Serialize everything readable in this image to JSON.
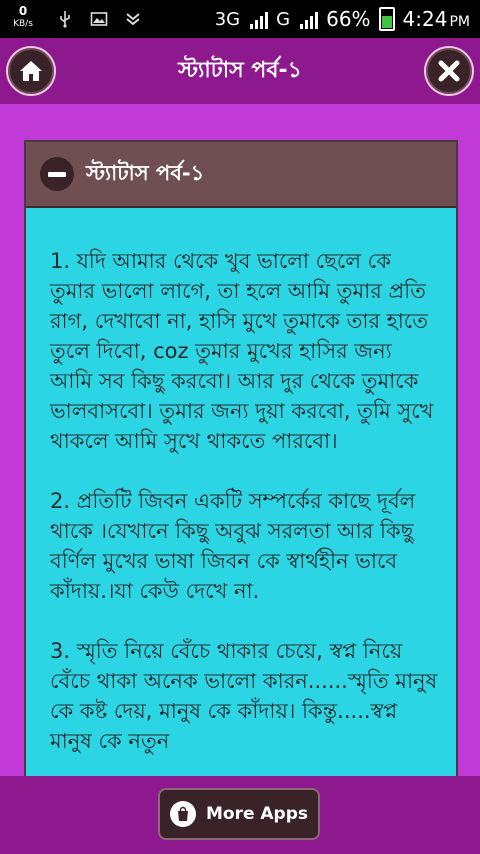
{
  "status_bar": {
    "speed_value": "0",
    "speed_unit": "KB/s",
    "network_1": "3G",
    "network_2": "G",
    "battery": "66%",
    "time": "4:24",
    "ampm": "PM"
  },
  "header": {
    "title": "স্ট্যাটাস পর্ব-১",
    "home_icon": "home-icon",
    "close_icon": "close-icon"
  },
  "panel": {
    "title": "স্ট্যাটাস পর্ব-১",
    "paragraphs": [
      "1. যদি আমার থেকে খুব ভালো ছেলে কে তুমার ভালো লাগে, তা হলে আমি তুমার প্রতি রাগ, দেখাবো না, হাসি মুখে তুমাকে তার হাতে তুলে দিবো, coz তুমার মুখের হাসির জন্য আমি সব কিছু করবো। আর দুর থেকে তুমাকে ভালবাসবো। তুমার জন্য দুয়া করবো, তুমি সুখে থাকলে আমি সুখে থাকতে পারবো।",
      "2. প্রতিটি জিবন একটি সম্পর্কের কাছে দূর্বল থাকে ।যেখানে কিছু অবুঝ সরলতা আর কিছু বর্ণিল মুখের ভাষা জিবন কে স্বার্থহীন ভাবে কাঁদায়.।যা কেউ দেখে না.",
      "3. স্মৃতি নিয়ে বেঁচে থাকার চেয়ে, স্বপ্ন নিয়ে বেঁচে থাকা অনেক ভালো কারন......স্মৃতি মানুষ কে কষ্ট দেয়, মানুষ কে কাঁদায়। কিন্তু.....স্বপ্ন মানুষ কে নতুন"
    ]
  },
  "bottom_bar": {
    "more_apps_label": "More Apps",
    "bag_icon": "shopping-bag-icon"
  },
  "colors": {
    "background": "#c13ad7",
    "bar": "#8e198f",
    "panel": "#2bd5e3",
    "panel_header": "#6f4f51"
  }
}
